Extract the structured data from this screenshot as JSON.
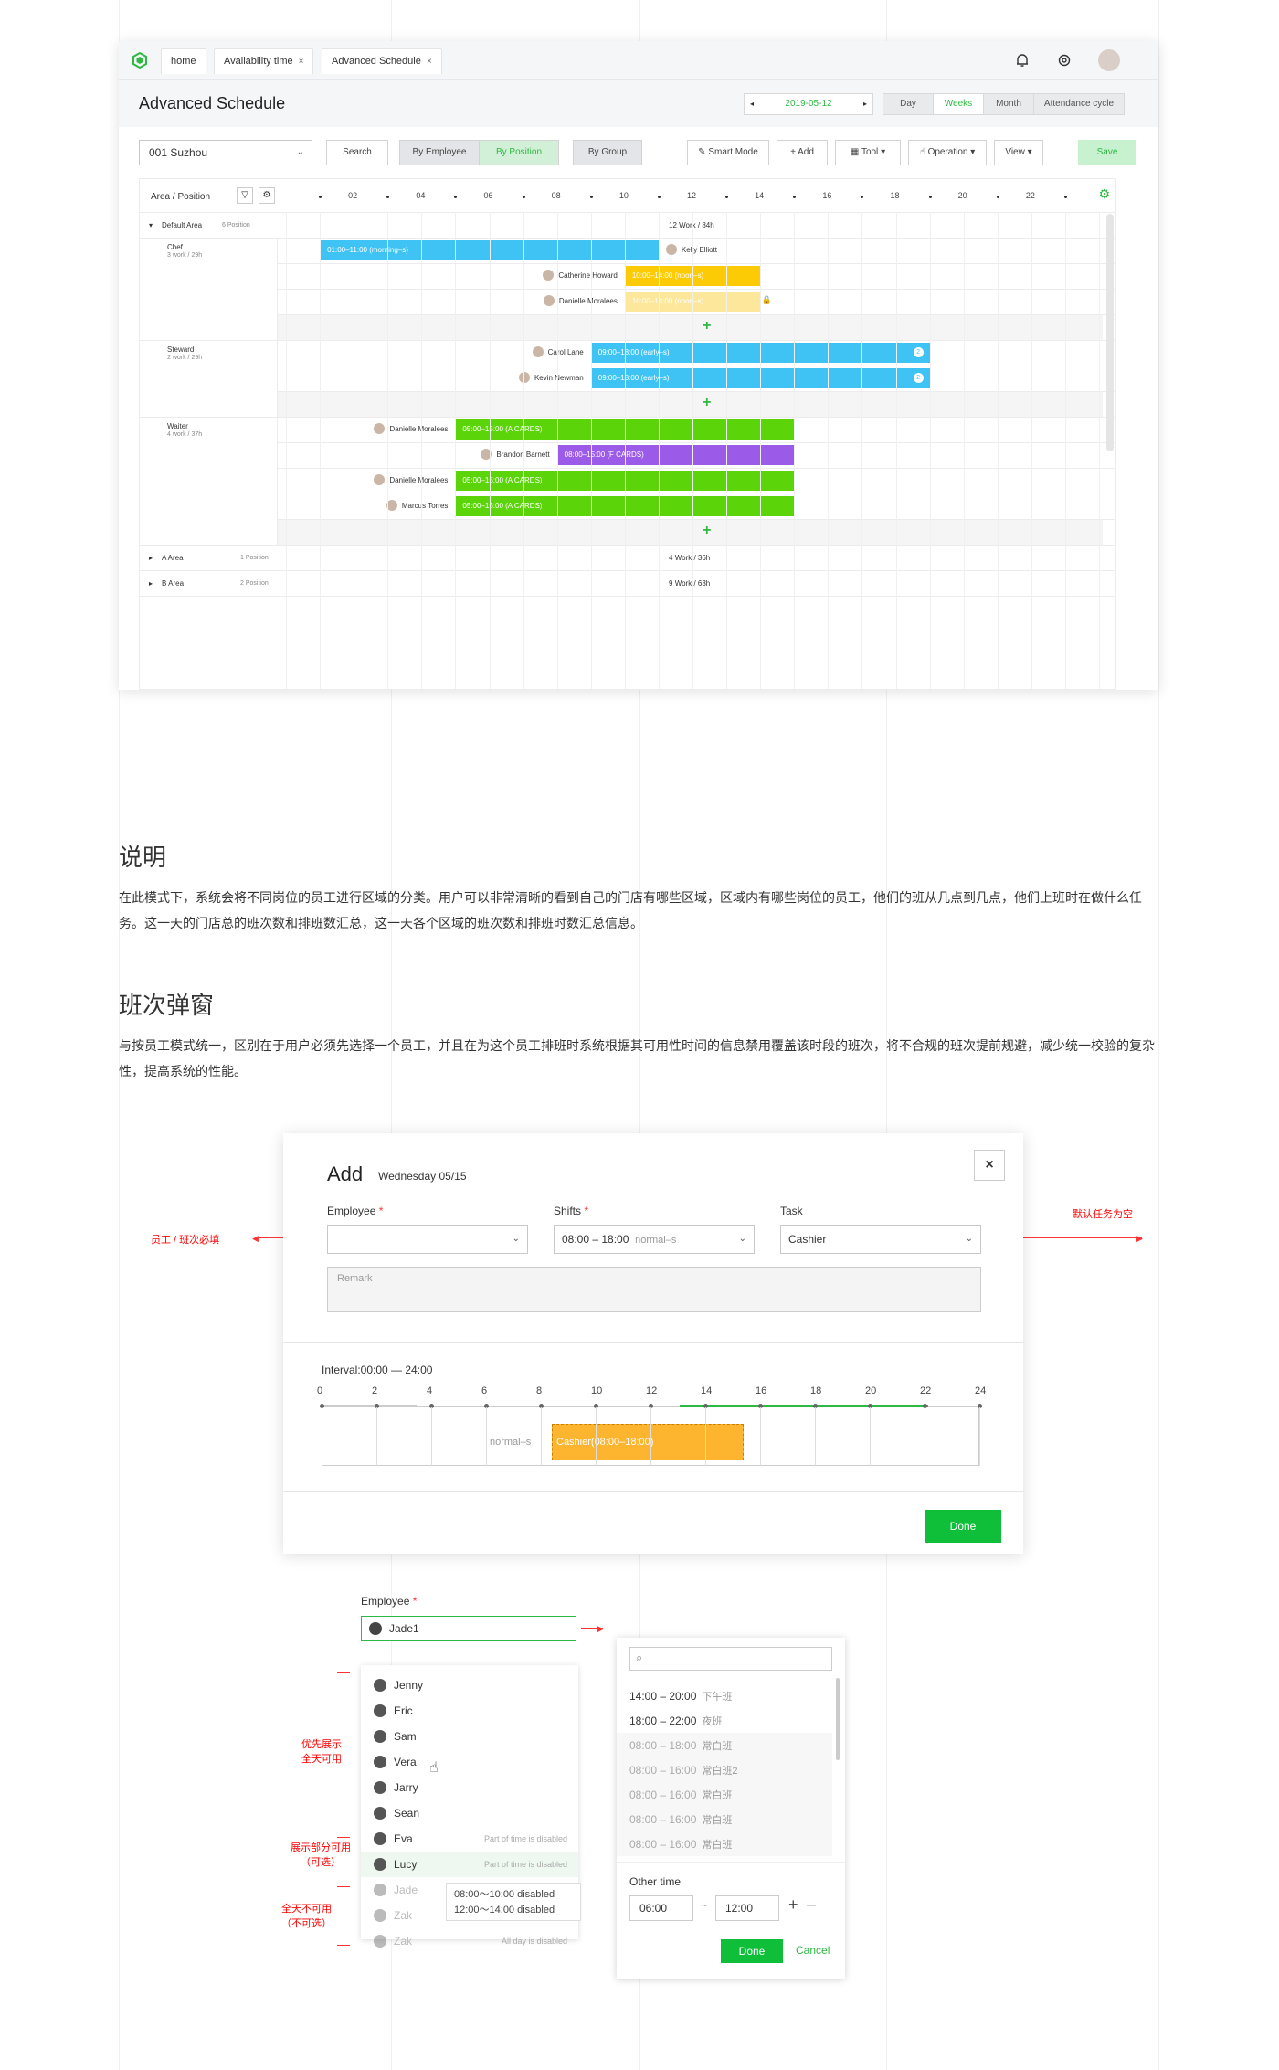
{
  "app": {
    "tabs": [
      {
        "label": "home",
        "closable": false
      },
      {
        "label": "Availability time",
        "closable": true
      },
      {
        "label": "Advanced Schedule",
        "closable": true
      }
    ],
    "close_glyph": "×",
    "page_title": "Advanced Schedule",
    "date": "2019-05-12",
    "date_prev": "◂",
    "date_next": "▸",
    "view_modes": [
      {
        "label": "Day",
        "active": false
      },
      {
        "label": "Weeks",
        "active": true
      },
      {
        "label": "Month",
        "active": false
      },
      {
        "label": "Attendance cycle",
        "active": false
      }
    ],
    "toolbar": {
      "store_select": "001 Suzhou",
      "search_label": "Search",
      "group_by": [
        {
          "label": "By Employee",
          "active": false
        },
        {
          "label": "By Position",
          "active": true
        }
      ],
      "by_group_label": "By Group",
      "smart_mode_label": "Smart Mode",
      "add_label": "Add",
      "tool_label": "Tool",
      "operation_label": "Operation",
      "view_label": "View",
      "save_label": "Save"
    },
    "grid": {
      "header_label_area": "Area",
      "header_label_sep": "/",
      "header_label_position": "Position",
      "hours": [
        "02",
        "04",
        "06",
        "08",
        "10",
        "12",
        "14",
        "16",
        "18",
        "20",
        "22"
      ],
      "default_area": {
        "name": "Default Area",
        "badge": "6 Position",
        "summary": "12 Work  /  84h",
        "positions": [
          {
            "name": "Chef",
            "sub": "3 work  / 29h",
            "rows": [
              {
                "employee": "",
                "bar": "01:00–11:00  (morning–s)",
                "color": "#3fc3f4",
                "start": 1,
                "end": 11,
                "right_employee": "Kelly Elliott"
              },
              {
                "employee": "Catherine Howard",
                "bar": "10:00–14:00  (noon–s)",
                "color": "#fdcb06",
                "start": 10,
                "end": 14
              },
              {
                "employee": "Danielle Moralees",
                "bar": "10:00–14:00  (noon–s)",
                "color": "#fde79a",
                "start": 10,
                "end": 14,
                "locked": true
              }
            ]
          },
          {
            "name": "Steward",
            "sub": "2 work  / 29h",
            "rows": [
              {
                "employee": "Carol Lane",
                "bar": "09:00–18:00  (early–s)",
                "color": "#3fc3f4",
                "start": 9,
                "end": 19,
                "badge": "2"
              },
              {
                "employee": "Kevin Newman",
                "bar": "09:00–18:00  (early–s)",
                "color": "#3fc3f4",
                "start": 9,
                "end": 19,
                "badge": "2"
              }
            ]
          },
          {
            "name": "Waiter",
            "sub": "4 work  / 37h",
            "rows": [
              {
                "employee": "Danielle Moralees",
                "bar": "05:00–15:00  (A CARDS)",
                "color": "#5cd40a",
                "start": 5,
                "end": 15
              },
              {
                "employee": "Brandon Barnett",
                "bar": "08:00–15:00  (F CARDS)",
                "color": "#9b5ae8",
                "start": 8,
                "end": 15
              },
              {
                "employee": "Danielle Moralees",
                "bar": "05:00–15:00  (A CARDS)",
                "color": "#5cd40a",
                "start": 5,
                "end": 15
              },
              {
                "employee": "Marcus Torres",
                "bar": "05:00–15:00  (A CARDS)",
                "color": "#5cd40a",
                "start": 5,
                "end": 15
              }
            ]
          }
        ]
      },
      "collapsed_areas": [
        {
          "name": "A Area",
          "badge": "1 Position",
          "summary": "4 Work  /  36h"
        },
        {
          "name": "B Area",
          "badge": "2 Position",
          "summary": "9 Work  /  63h"
        }
      ],
      "add_glyph": "+"
    }
  },
  "section1": {
    "title": "说明",
    "body": "在此模式下，系统会将不同岗位的员工进行区域的分类。用户可以非常清晰的看到自己的门店有哪些区域，区域内有哪些岗位的员工，他们的班从几点到几点，他们上班时在做什么任务。这一天的门店总的班次数和排班数汇总，这一天各个区域的班次数和排班时数汇总信息。"
  },
  "section2": {
    "title": "班次弹窗",
    "body": "与按员工模式统一，区别在于用户必须先选择一个员工，并且在为这个员工排班时系统根据其可用性时间的信息禁用覆盖该时段的班次，将不合规的班次提前规避，减少统一校验的复杂性，提高系统的性能。"
  },
  "modal": {
    "title": "Add",
    "date": "Wednesday  05/15",
    "close_glyph": "×",
    "employee_label": "Employee",
    "shifts_label": "Shifts",
    "shifts_value": "08:00 – 18:00",
    "shifts_tag": "normal–s",
    "task_label": "Task",
    "task_value": "Cashier",
    "remark_placeholder": "Remark",
    "interval_label": "Interval:00:00 — 24:00",
    "ticks": [
      "0",
      "2",
      "4",
      "6",
      "8",
      "10",
      "12",
      "14",
      "16",
      "18",
      "20",
      "22",
      "24"
    ],
    "timeline_left_label": "normal–s",
    "timeline_block": "Cashier(08:00–18:00)",
    "done_label": "Done",
    "annotation_left": "员工 / 班次必填",
    "annotation_right": "默认任务为空"
  },
  "employee_picker": {
    "label": "Employee",
    "selected": "Jade1",
    "items": [
      {
        "name": "Jenny",
        "state": "available"
      },
      {
        "name": "Eric",
        "state": "available"
      },
      {
        "name": "Sam",
        "state": "available"
      },
      {
        "name": "Vera",
        "state": "available"
      },
      {
        "name": "Jarry",
        "state": "available"
      },
      {
        "name": "Sean",
        "state": "available"
      },
      {
        "name": "Eva",
        "state": "partial",
        "note": "Part of time is disabled"
      },
      {
        "name": "Lucy",
        "state": "partial",
        "note": "Part of time is disabled"
      },
      {
        "name": "Jade",
        "state": "disabled"
      },
      {
        "name": "Zak",
        "state": "disabled"
      },
      {
        "name": "Zak",
        "state": "disabled",
        "note": "All day is disabled"
      }
    ],
    "tooltip_lines": [
      "08:00～10:00 disabled",
      "12:00～14:00  disabled"
    ],
    "annotations": [
      {
        "text": "优先展示\n全天可用"
      },
      {
        "text": "展示部分可用\n（可选）"
      },
      {
        "text": "全天不可用\n（不可选）"
      }
    ]
  },
  "shift_picker": {
    "search_placeholder": "",
    "items": [
      {
        "time": "14:00 – 20:00",
        "name": "下午班",
        "disabled": false
      },
      {
        "time": "18:00 – 22:00",
        "name": "夜班",
        "disabled": false
      },
      {
        "time": "08:00 – 18:00",
        "name": "常白班",
        "disabled": true
      },
      {
        "time": "08:00 – 16:00",
        "name": "常白班2",
        "disabled": true
      },
      {
        "time": "08:00 – 16:00",
        "name": "常白班",
        "disabled": true
      },
      {
        "time": "08:00 – 16:00",
        "name": "常白班",
        "disabled": true
      },
      {
        "time": "08:00 – 16:00",
        "name": "常白班",
        "disabled": true
      }
    ],
    "other_time_label": "Other time",
    "from": "06:00",
    "to": "12:00",
    "range_sep": "~",
    "add_glyph": "+",
    "remove_glyph": "—",
    "done_label": "Done",
    "cancel_label": "Cancel"
  },
  "colors": {
    "accent_green": "#2fb843",
    "blue_shift": "#3fc3f4",
    "yellow_shift": "#fdcb06",
    "green_shift": "#5cd40a",
    "purple_shift": "#9b5ae8",
    "orange_block": "#fdb42e",
    "annotation_red": "#f00"
  }
}
